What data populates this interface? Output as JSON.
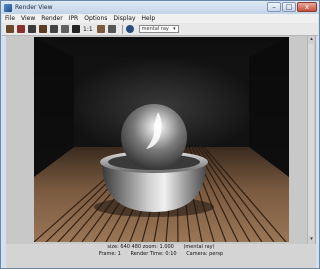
{
  "window": {
    "title": "Render View",
    "controls": {
      "minimize": "–",
      "maximize": "□",
      "close": "x"
    }
  },
  "menu": [
    "File",
    "View",
    "Render",
    "IPR",
    "Options",
    "Display",
    "Help"
  ],
  "toolbar": {
    "ratio_label": "1:1",
    "renderer_select": "mental ray"
  },
  "status": {
    "size": "size:  640  480 zoom: 1.000",
    "renderer": "(mental ray)",
    "frame": "Frame: 1",
    "render_time": "Render Time: 0:10",
    "camera": "Camera: persp"
  },
  "colors": {
    "floor_light": "#8a6a50",
    "floor_dark": "#3a2a1e",
    "background": "#1b1b1b",
    "chrome": "#b8b8b8"
  }
}
